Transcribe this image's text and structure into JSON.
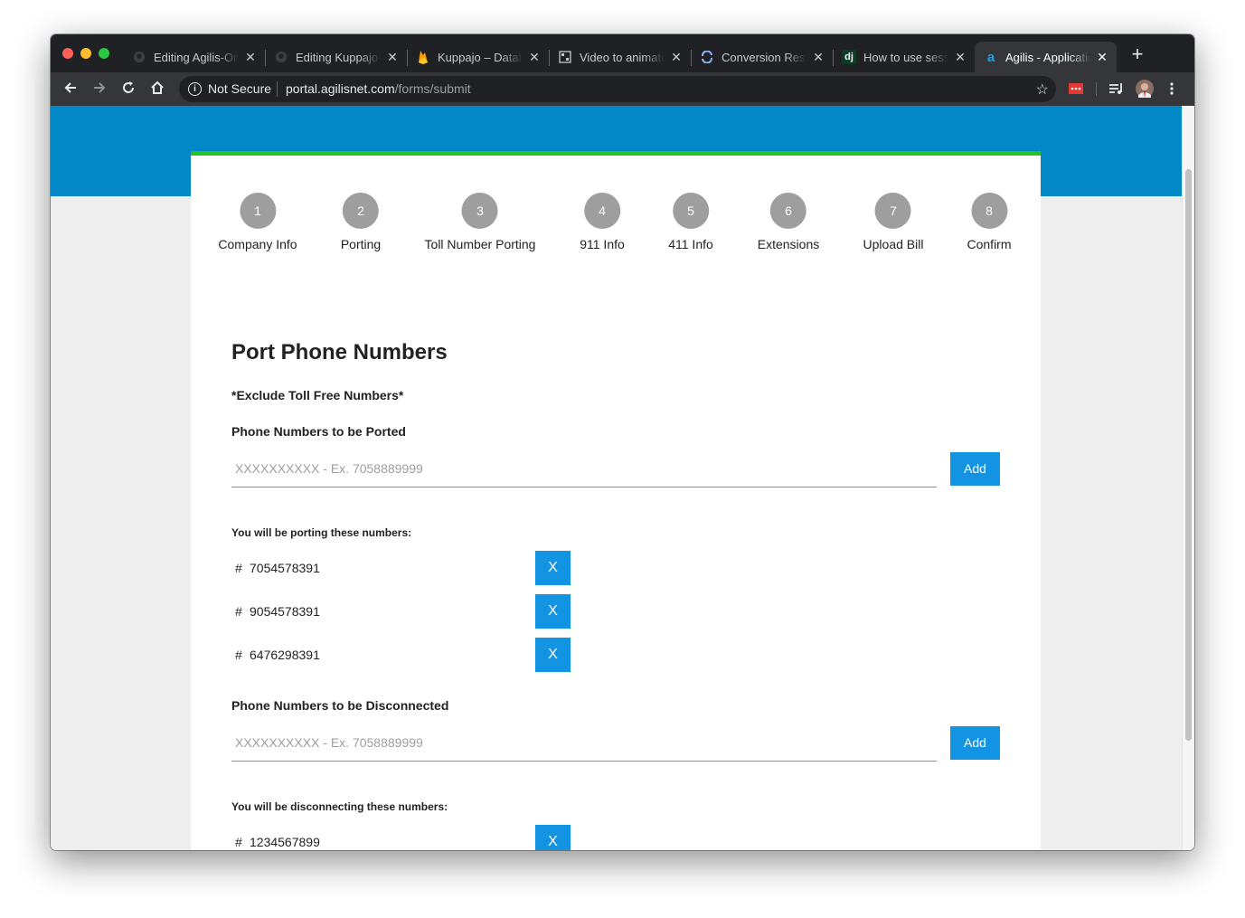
{
  "browser": {
    "tabs": [
      {
        "title": "Editing Agilis-Onboarding",
        "favicon": "github-icon",
        "active": false
      },
      {
        "title": "Editing Kuppajo-Readme",
        "favicon": "github-icon",
        "active": false
      },
      {
        "title": "Kuppajo – Database",
        "favicon": "firebase-icon",
        "active": false
      },
      {
        "title": "Video to animated GIF",
        "favicon": "gif-icon",
        "active": false
      },
      {
        "title": "Conversion Results",
        "favicon": "convert-icon",
        "active": false
      },
      {
        "title": "How to use sessions",
        "favicon": "django-icon",
        "favicon_text": "dj",
        "active": false
      },
      {
        "title": "Agilis - Application",
        "favicon": "agilis-icon",
        "favicon_text": "a",
        "active": true
      }
    ],
    "new_tab": "+",
    "address": {
      "security": "Not Secure",
      "host": "portal.agilisnet.com",
      "path": "/forms/submit"
    }
  },
  "steps": [
    {
      "num": "1",
      "label": "Company Info"
    },
    {
      "num": "2",
      "label": "Porting"
    },
    {
      "num": "3",
      "label": "Toll Number Porting"
    },
    {
      "num": "4",
      "label": "911 Info"
    },
    {
      "num": "5",
      "label": "411 Info"
    },
    {
      "num": "6",
      "label": "Extensions"
    },
    {
      "num": "7",
      "label": "Upload Bill"
    },
    {
      "num": "8",
      "label": "Confirm"
    }
  ],
  "form": {
    "title": "Port Phone Numbers",
    "note": "*Exclude Toll Free Numbers*",
    "ported": {
      "label": "Phone Numbers to be Ported",
      "placeholder": "XXXXXXXXXX - Ex. 7058889999",
      "add_label": "Add",
      "list_label": "You will be porting these numbers:",
      "numbers": [
        "7054578391",
        "9054578391",
        "6476298391"
      ]
    },
    "disconnected": {
      "label": "Phone Numbers to be Disconnected",
      "placeholder": "XXXXXXXXXX - Ex. 7058889999",
      "add_label": "Add",
      "list_label": "You will be disconnecting these numbers:",
      "numbers": [
        "1234567899"
      ]
    },
    "hash": "#",
    "remove_label": "X"
  },
  "colors": {
    "hero": "#0288c7",
    "accent": "#22c32b",
    "button": "#1294e2",
    "step_circle": "#9e9e9e"
  }
}
